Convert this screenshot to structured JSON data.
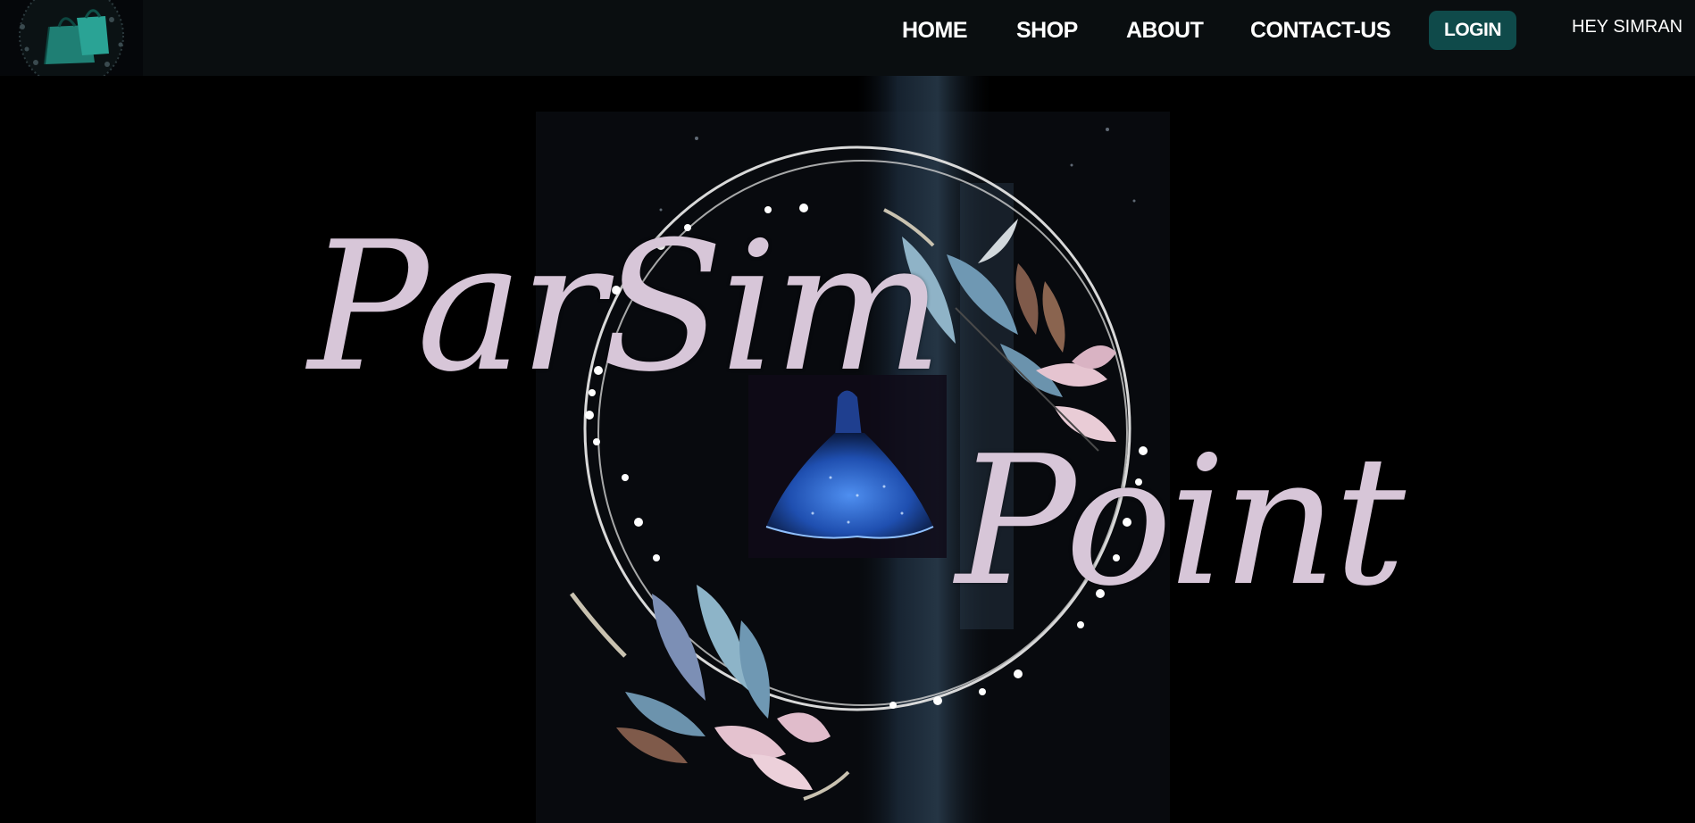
{
  "header": {
    "logo_icon": "shopping-bags-icon",
    "nav": {
      "home": "HOME",
      "shop": "SHOP",
      "about": "ABOUT",
      "contact": "CONTACT-US"
    },
    "login_label": "LOGIN",
    "greeting": "HEY SIMRAN"
  },
  "hero": {
    "brand_line_1": "ParSim",
    "brand_line_2": "Point",
    "illustration": "ball-gown-icon",
    "decoration": "floral-wreath"
  },
  "colors": {
    "background": "#000000",
    "navbar": "#0a0e10",
    "login_button": "#0f4a4a",
    "brand_text": "#d7c6d8",
    "leaf_blue": "#7fa8c0",
    "leaf_pink": "#e2c0cc",
    "leaf_brown": "#6b4a3a"
  }
}
